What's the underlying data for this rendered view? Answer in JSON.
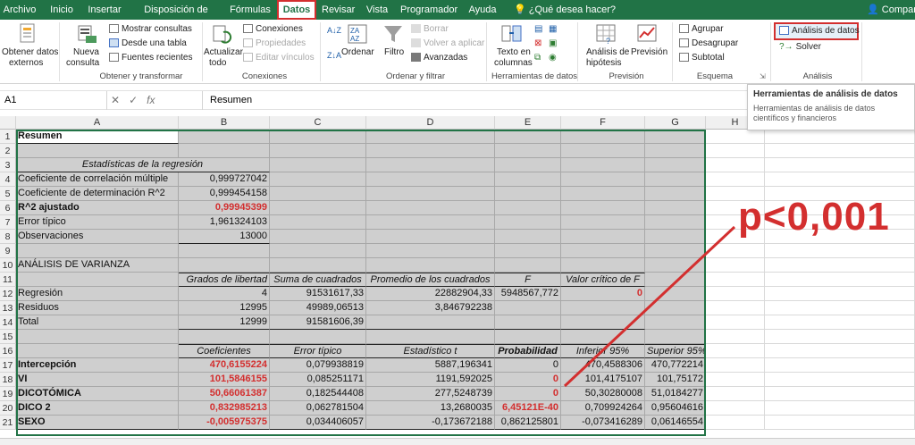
{
  "menu": {
    "tabs": [
      "Archivo",
      "Inicio",
      "Insertar",
      "Disposición de página",
      "Fórmulas",
      "Datos",
      "Revisar",
      "Vista",
      "Programador",
      "Ayuda"
    ],
    "active_tab": "Datos",
    "tell_me": "¿Qué desea hacer?",
    "share": "Compartir"
  },
  "ribbon": {
    "obtener_datos": "Obtener datos",
    "externos": "externos",
    "nueva": "Nueva",
    "consulta": "consulta",
    "mostrar_consultas": "Mostrar consultas",
    "desde_tabla": "Desde una tabla",
    "fuentes_recientes": "Fuentes recientes",
    "group_obtener": "Obtener y transformar",
    "actualizar": "Actualizar",
    "todo": "todo",
    "conexiones": "Conexiones",
    "propiedades": "Propiedades",
    "editar_vinculos": "Editar vínculos",
    "group_conexiones": "Conexiones",
    "ordenar": "Ordenar",
    "filtro": "Filtro",
    "borrar": "Borrar",
    "volver_aplicar": "Volver a aplicar",
    "avanzadas": "Avanzadas",
    "group_ordenar": "Ordenar y filtrar",
    "texto_en": "Texto en",
    "columnas": "columnas",
    "group_herramientas": "Herramientas de datos",
    "analisis_de": "Análisis de",
    "hipotesis": "hipótesis",
    "prevision": "Previsión",
    "group_prevision": "Previsión",
    "agrupar": "Agrupar",
    "desagrupar": "Desagrupar",
    "subtotal": "Subtotal",
    "group_esquema": "Esquema",
    "analisis_datos": "Análisis de datos",
    "solver": "Solver",
    "group_analisis": "Análisis"
  },
  "tooltip": {
    "title": "Herramientas de análisis de datos",
    "body": "Herramientas de análisis de datos científicos y financieros"
  },
  "formula_bar": {
    "name_box": "A1",
    "value": "Resumen"
  },
  "columns": [
    "A",
    "B",
    "C",
    "D",
    "E",
    "F",
    "G",
    "H",
    "I"
  ],
  "rows": [
    "1",
    "2",
    "3",
    "4",
    "5",
    "6",
    "7",
    "8",
    "9",
    "10",
    "11",
    "12",
    "13",
    "14",
    "15",
    "16",
    "17",
    "18",
    "19",
    "20",
    "21"
  ],
  "sheet": {
    "r1": {
      "a": "Resumen"
    },
    "r3": {
      "a": "Estadísticas de la regresión"
    },
    "r4": {
      "a": "Coeficiente de correlación múltiple",
      "b": "0,999727042"
    },
    "r5": {
      "a": "Coeficiente de determinación R^2",
      "b": "0,999454158"
    },
    "r6": {
      "a": "R^2  ajustado",
      "b": "0,99945399"
    },
    "r7": {
      "a": "Error típico",
      "b": "1,961324103"
    },
    "r8": {
      "a": "Observaciones",
      "b": "13000"
    },
    "r10": {
      "a": "ANÁLISIS DE VARIANZA"
    },
    "r11": {
      "b": "Grados de libertad",
      "c": "Suma de cuadrados",
      "d": "Promedio de los cuadrados",
      "e": "F",
      "f": "Valor crítico de F"
    },
    "r12": {
      "a": "Regresión",
      "b": "4",
      "c": "91531617,33",
      "d": "22882904,33",
      "e": "5948567,772",
      "f": "0"
    },
    "r13": {
      "a": "Residuos",
      "b": "12995",
      "c": "49989,06513",
      "d": "3,846792238"
    },
    "r14": {
      "a": "Total",
      "b": "12999",
      "c": "91581606,39"
    },
    "r16": {
      "b": "Coeficientes",
      "c": "Error típico",
      "d": "Estadístico t",
      "e": "Probabilidad",
      "f": "Inferior 95%",
      "g": "Superior 95%"
    },
    "r17": {
      "a": "Intercepción",
      "b": "470,6155224",
      "c": "0,079938819",
      "d": "5887,196341",
      "e": "0",
      "f": "470,4588306",
      "g": "470,772214"
    },
    "r18": {
      "a": "VI",
      "b": "101,5846155",
      "c": "0,085251171",
      "d": "1191,592025",
      "e": "0",
      "f": "101,4175107",
      "g": "101,75172"
    },
    "r19": {
      "a": "DICOTÓMICA",
      "b": "50,66061387",
      "c": "0,182544408",
      "d": "277,5248739",
      "e": "0",
      "f": "50,30280008",
      "g": "51,0184277"
    },
    "r20": {
      "a": "DICO 2",
      "b": "0,832985213",
      "c": "0,062781504",
      "d": "13,2680035",
      "e": "6,45121E-40",
      "f": "0,709924264",
      "g": "0,95604616"
    },
    "r21": {
      "a": "SEXO",
      "b": "-0,005975375",
      "c": "0,034406057",
      "d": "-0,173672188",
      "e": "0,862125801",
      "f": "-0,073416289",
      "g": "0,06146554"
    }
  },
  "annotation": {
    "text": "p<0,001",
    "color": "#d32f2f"
  },
  "colors": {
    "excel_green": "#217346",
    "highlight_red": "#d32f2f",
    "selection_gray": "#cfcfcf"
  }
}
